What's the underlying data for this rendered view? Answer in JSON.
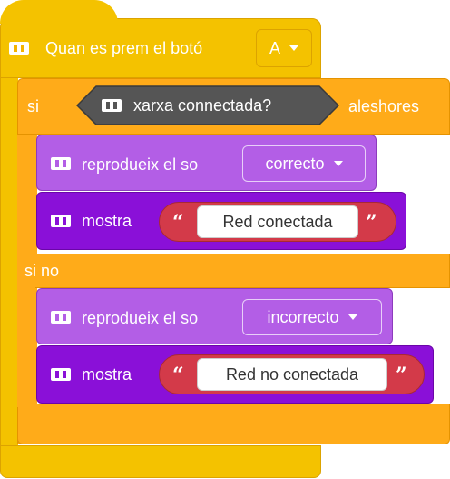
{
  "event_block": {
    "label": "Quan es prem el botó",
    "button_value": "A",
    "icon": "robot-icon"
  },
  "if_block": {
    "if_label": "si",
    "condition": "xarxa connectada?",
    "then_label": "aleshores",
    "else_label": "si no"
  },
  "then_branch": {
    "play_label": "reprodueix el so",
    "play_sound": "correcto",
    "show_label": "mostra",
    "show_text": "Red conectada"
  },
  "else_branch": {
    "play_label": "reprodueix el so",
    "play_sound": "incorrecto",
    "show_label": "mostra",
    "show_text": "Red no conectada"
  },
  "quotes": {
    "open": "“",
    "close": "”"
  },
  "colors": {
    "event": "#f4c200",
    "control": "#ffab19",
    "sound": "#b35ee6",
    "display": "#8a10d8",
    "sensing": "#555555",
    "string": "#d33a49"
  }
}
